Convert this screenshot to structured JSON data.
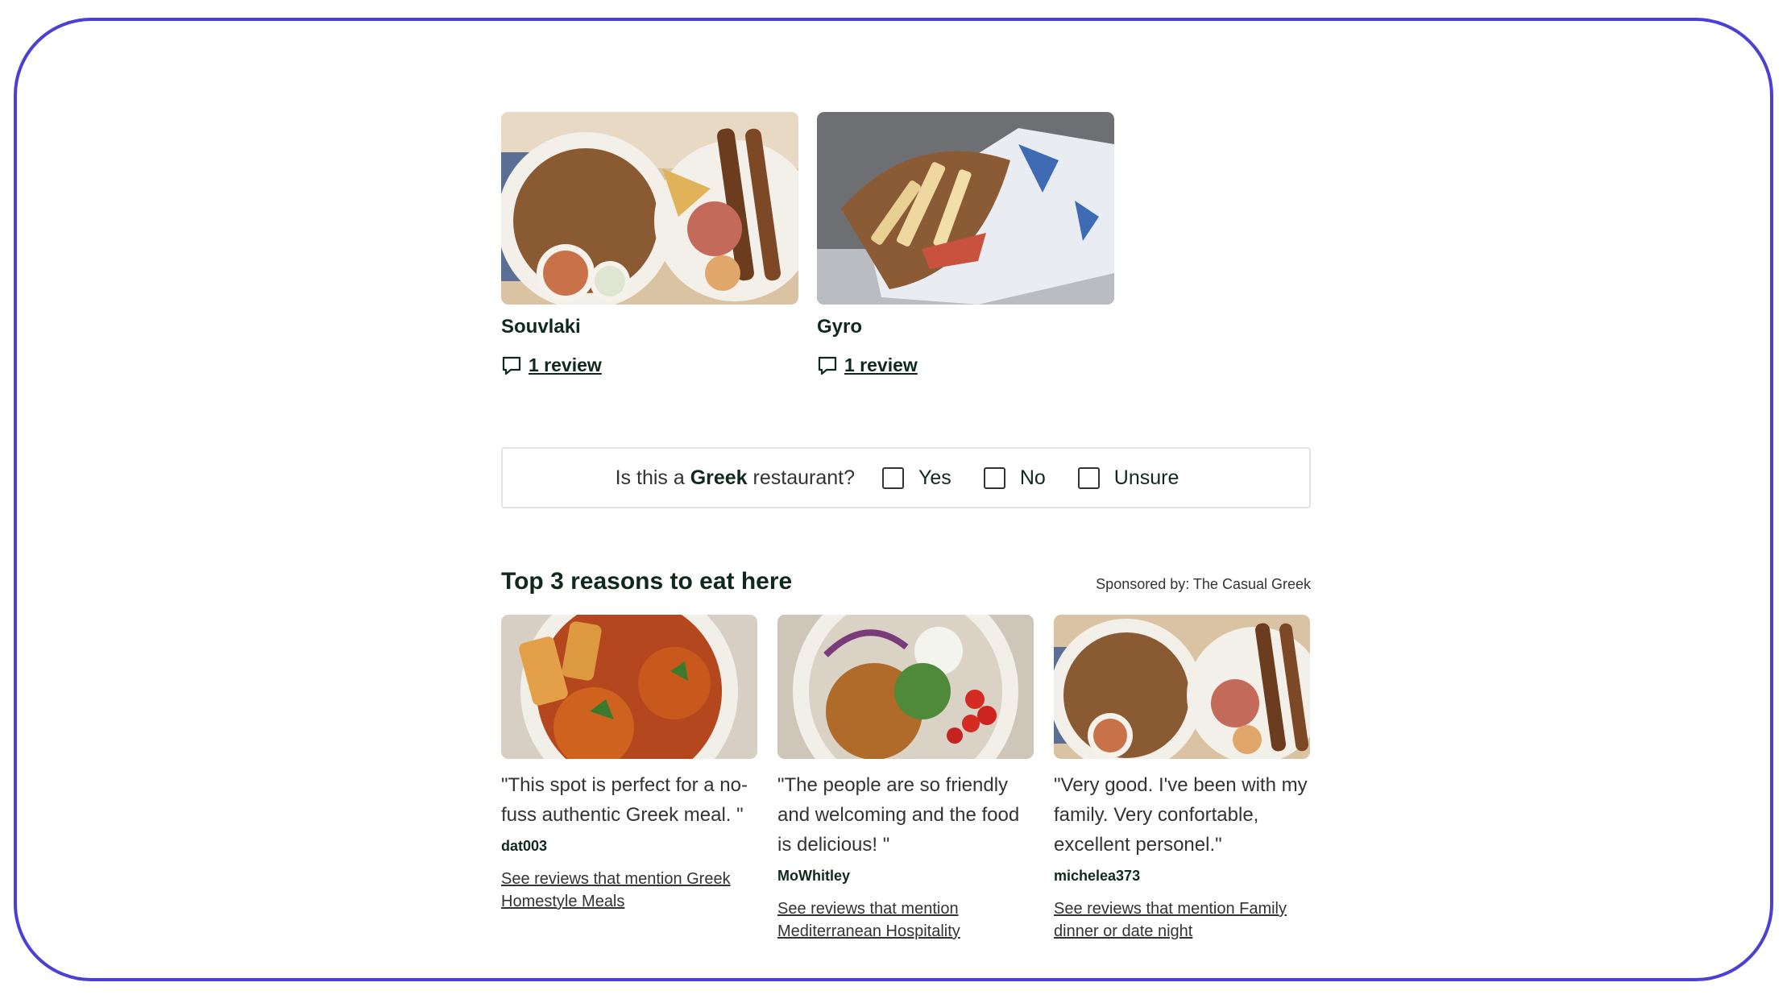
{
  "dishes": [
    {
      "name": "Souvlaki",
      "reviews": "1 review"
    },
    {
      "name": "Gyro",
      "reviews": "1 review"
    }
  ],
  "question": {
    "prefix": "Is this a ",
    "cuisine": "Greek",
    "suffix": " restaurant?",
    "options": [
      "Yes",
      "No",
      "Unsure"
    ]
  },
  "reasons": {
    "title": "Top 3 reasons to eat here",
    "sponsored": "Sponsored by: The Casual Greek",
    "items": [
      {
        "quote": "\"This spot is perfect for a no-fuss authentic Greek meal. \"",
        "author": "dat003",
        "link": "See reviews that mention Greek Homestyle Meals"
      },
      {
        "quote": "\"The people are so friendly and welcoming and the food is delicious! \"",
        "author": "MoWhitley",
        "link": "See reviews that mention Mediterranean Hospitality"
      },
      {
        "quote": "\"Very good. I've been with my family. Very confortable, excellent personel.\"",
        "author": "michelea373",
        "link": "See reviews that mention Family dinner or date night"
      }
    ]
  },
  "colors": {
    "frame": "#4b3fd6",
    "text_dark": "#0f2a1c"
  },
  "icons": {
    "review": "speech-bubble-icon"
  }
}
